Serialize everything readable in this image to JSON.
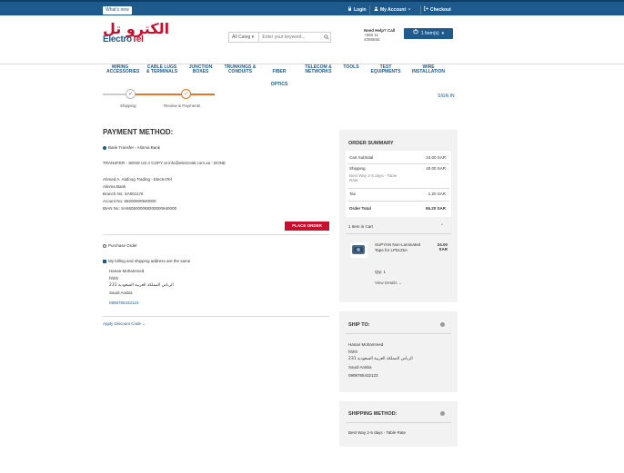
{
  "topbar": {
    "whats_new": "What's new",
    "login": "Login",
    "my_account": "My Account",
    "checkout": "Checkout"
  },
  "header": {
    "logo_ar": "الكترو تل",
    "logo_en_1": "Electro",
    "logo_en_2": "Tel",
    "search_category": "All Categ",
    "search_placeholder": "Enter your keyword...",
    "help_title": "Need Help? Call",
    "help_phone_1": "+966 11",
    "help_phone_2": "4098555",
    "cart_label": "1 Item(s)"
  },
  "nav": {
    "items": [
      "WIRING ACCESSORIES",
      "CABLE LUGS & TERMINALS",
      "JUNCTION BOXES",
      "TRUNKINGS & CONDUITS",
      "FIBER OPTICS",
      "TELECOM & NETWORKS",
      "TOOLS",
      "TEST EQUIPMENTS",
      "WIRE INSTALLATION"
    ]
  },
  "progress": {
    "step1": "Shipping",
    "step2": "Review & Payments",
    "sign_in": "SIGN IN",
    "accent": "#e8742a"
  },
  "payment": {
    "title": "PAYMENT METHOD:",
    "bank_option": "Bank Transfer - Alinma Bank",
    "transfer_note": "TRANSFER - SEND US A COPY at info@electrotel.com.sa - DONE",
    "bank_lines": [
      "Ahmed A. Alafoog Trading - ElectroTel",
      "Alinma Bank",
      "Branch No: SA001176",
      "Acount No: 68200000940000",
      "IBAN No: SA5605000068200000940000"
    ],
    "place_order": "PLACE ORDER",
    "purchase_option": "Purchase Order",
    "same_address": "My billing and shipping address are the same",
    "address": {
      "name": "Hanan Mohammed",
      "street": "hhhh",
      "city_line": "الرياض المملكة العربية السعودية 231",
      "country": "Saudi Arabia",
      "phone": "0998765432123"
    },
    "discount_link": "Apply Discount Code"
  },
  "summary": {
    "title": "ORDER SUMMARY",
    "cart_subtotal_label": "Cart Subtotal",
    "cart_subtotal_value": "24.00 SAR",
    "shipping_label": "Shipping",
    "shipping_value": "40.00 SAR",
    "shipping_note": "Best Way 2-5 days - Table Rate",
    "tax_label": "Tax",
    "tax_value": "1.20 SAR",
    "order_total_label": "Order Total",
    "order_total_value": "65.20 SAR",
    "items_in_cart": "1 Item in Cart",
    "item_name": "SUPYAN Non-Laminated Tape for LP5125A",
    "item_price": "24.00 SAR",
    "item_qty": "Qty: 1",
    "view_details": "View Details"
  },
  "ship_to": {
    "title": "SHIP TO:",
    "name": "Hanan Mohammed",
    "street": "hhhh",
    "city_line": "الرياض المملكة العربية السعودية 231",
    "country": "Saudi Arabia",
    "phone": "0998765432123"
  },
  "shipping_method": {
    "title": "SHIPPING METHOD:",
    "value": "Best Way 2-5 days - Table Rate"
  },
  "colors": {
    "brand_blue": "#1e5a8c",
    "brand_red": "#c8102e",
    "accent_orange": "#e8742a"
  }
}
